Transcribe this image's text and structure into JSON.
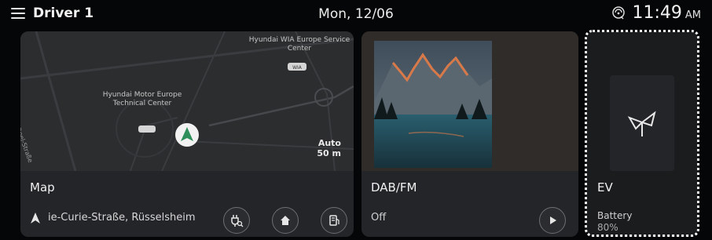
{
  "status_bar": {
    "driver": "Driver 1",
    "date": "Mon, 12/06",
    "time": "11:49",
    "ampm": "AM"
  },
  "map": {
    "title": "Map",
    "street": "ie-Curie-Straße, Rüsselsheim",
    "labels": {
      "wia": "Hyundai WIA Europe Service Center",
      "wia_badge": "WIA",
      "motor": "Hyundai Motor Europe Technical Center",
      "street_vertical": "Adam-Opel-Straße",
      "zoom_mode": "Auto",
      "zoom_distance": "50 m"
    },
    "buttons": [
      "charging-station",
      "home",
      "fuel-station"
    ]
  },
  "media": {
    "title": "DAB/FM",
    "status": "Off"
  },
  "ev": {
    "title": "EV",
    "battery_label": "Battery",
    "battery_value": "80%"
  },
  "colors": {
    "background": "#050607",
    "card": "#1d1f21",
    "info_bar": "#232528",
    "nav_arrow": "#2e8f5a",
    "focus": "#ffffff"
  }
}
